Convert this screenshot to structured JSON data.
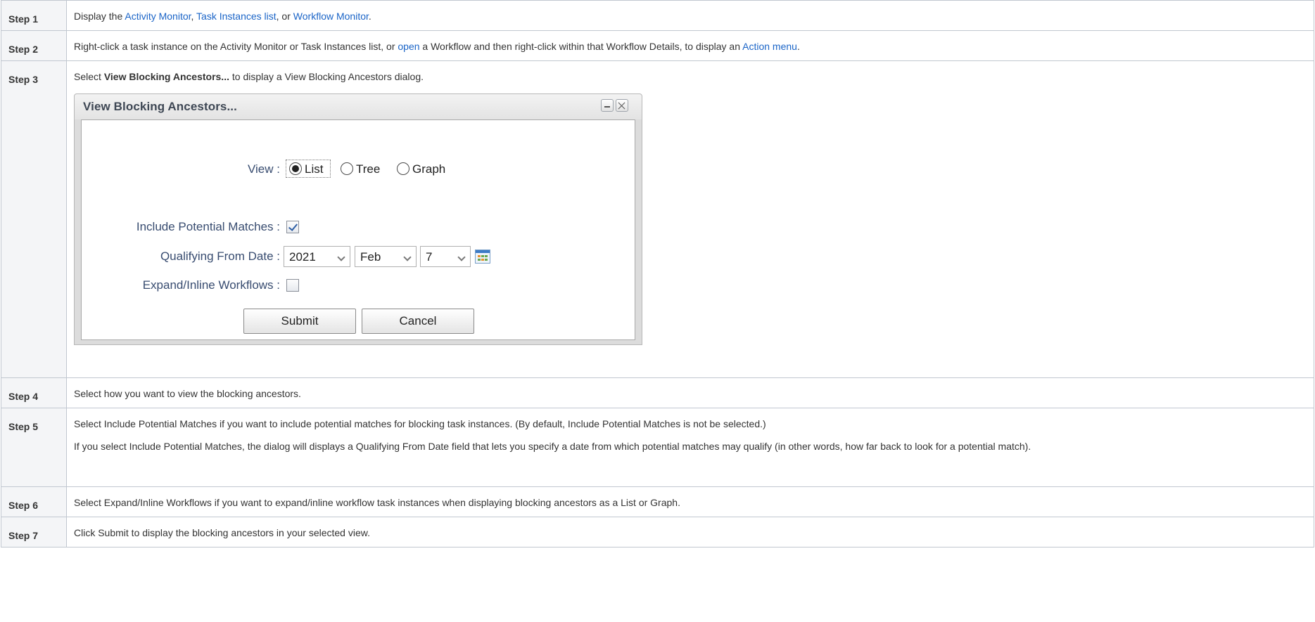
{
  "steps": [
    {
      "label": "Step 1",
      "text_1": "Display the ",
      "link_1": "Activity Monitor",
      "text_2": ", ",
      "link_2": "Task Instances list",
      "text_3": ", or ",
      "link_3": "Workflow Monitor",
      "text_4": "."
    },
    {
      "label": "Step 2",
      "text_1": "Right-click a task instance on the Activity Monitor or Task Instances list, or ",
      "link_1": "open",
      "text_2": " a Workflow and then right-click within that Workflow Details, to display an ",
      "link_2": "Action menu",
      "text_3": "."
    },
    {
      "label": "Step 3",
      "text_1": "Select ",
      "bold": "View Blocking Ancestors...",
      "text_2": " to display a View Blocking Ancestors dialog."
    },
    {
      "label": "Step 4",
      "text": "Select how you want to view the blocking ancestors."
    },
    {
      "label": "Step 5",
      "para_1": "Select Include Potential Matches if you want to include potential matches for blocking task instances. (By default, Include Potential Matches is not be selected.)",
      "para_2": "If you select Include Potential Matches, the dialog will displays a Qualifying From Date field that lets you specify a date from which potential matches may qualify (in other words, how far back to look for a potential match)."
    },
    {
      "label": "Step 6",
      "text": "Select Expand/Inline Workflows if you want to expand/inline workflow task instances when displaying blocking ancestors as a List or Graph."
    },
    {
      "label": "Step 7",
      "text": "Click Submit to display the blocking ancestors in your selected view."
    }
  ],
  "dialog": {
    "title": "View Blocking Ancestors...",
    "view_label": "View :",
    "view_options": [
      "List",
      "Tree",
      "Graph"
    ],
    "view_selected": "List",
    "include_label": "Include Potential Matches :",
    "include_checked": true,
    "date_label": "Qualifying From Date :",
    "date_year": "2021",
    "date_month": "Feb",
    "date_day": "7",
    "expand_label": "Expand/Inline Workflows :",
    "expand_checked": false,
    "submit_label": "Submit",
    "cancel_label": "Cancel"
  },
  "colors": {
    "link": "#1a64c7",
    "label_text": "#384c70",
    "step_cell_bg": "#f4f5f7",
    "border": "#c1c7d0"
  }
}
